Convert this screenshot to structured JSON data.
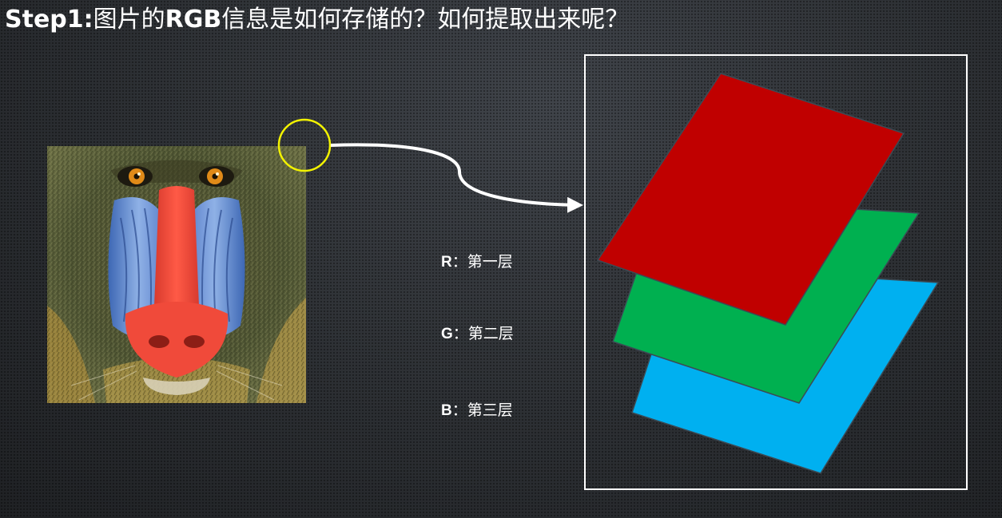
{
  "title": {
    "prefix": "Step1:",
    "part1": "图片的",
    "rgb": "RGB",
    "part2": "信息是如何存储的？如何提取出来呢？"
  },
  "layers": [
    {
      "channel": "R",
      "separator": "：",
      "text": "第一层",
      "color": "#c00000"
    },
    {
      "channel": "G",
      "separator": "：",
      "text": "第二层",
      "color": "#00b050"
    },
    {
      "channel": "B",
      "separator": "：",
      "text": "第三层",
      "color": "#00b0f0"
    }
  ],
  "highlight_color": "#f2f200",
  "arrow_color": "#ffffff"
}
